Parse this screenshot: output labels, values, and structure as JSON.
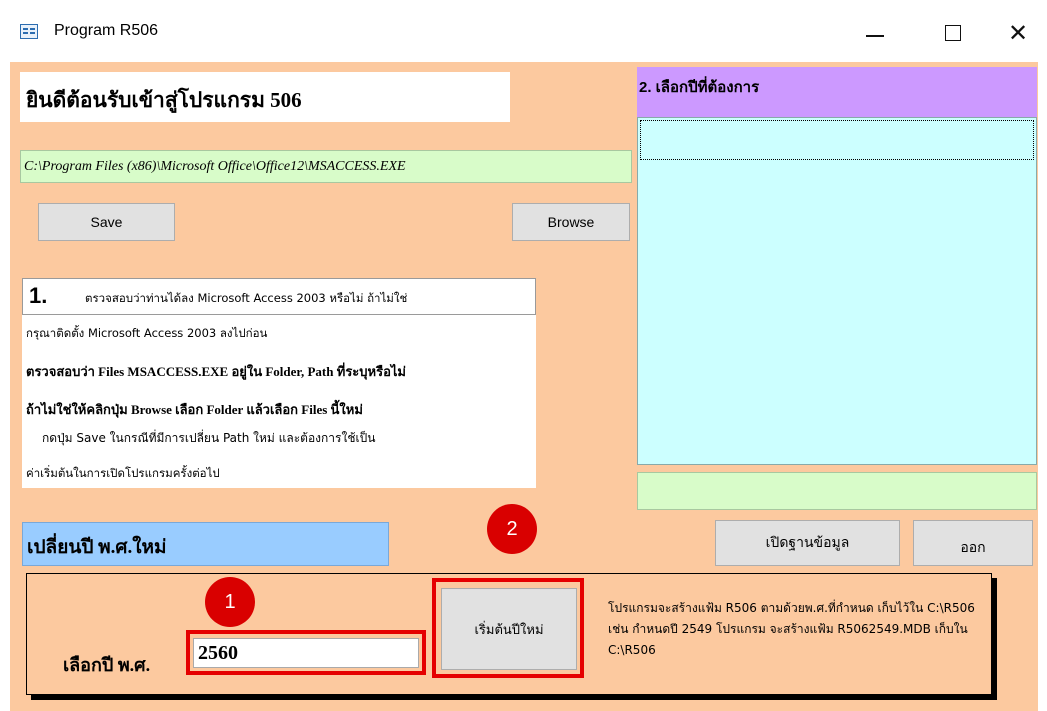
{
  "window": {
    "title": "Program R506",
    "icon": "form-icon",
    "controls": {
      "minimize": "—",
      "maximize": "☐",
      "close": "✕"
    }
  },
  "welcome_text": "ยินดีต้อนรับเข้าสู่โปรแกรม 506",
  "access_path": "C:\\Program Files (x86)\\Microsoft Office\\Office12\\MSACCESS.EXE",
  "buttons": {
    "save": "Save",
    "browse": "Browse",
    "open_database": "เปิดฐานข้อมูล",
    "exit": "ออก",
    "start_new_year": "เริ่มต้นปีใหม่"
  },
  "instructions": {
    "step_number": "1.",
    "line1": "ตรวจสอบว่าท่านได้ลง Microsoft Access 2003 หรือไม่ ถ้าไม่ใช่",
    "line2": "กรุณาติดตั้ง Microsoft Access 2003 ลงไปก่อน",
    "line3": "ตรวจสอบว่า Files  MSACCESS.EXE อยู่ใน Folder, Path ที่ระบุหรือไม่",
    "line4": "ถ้าไม่ใช่ให้คลิกปุ่ม  Browse เลือก Folder แล้วเลือก Files นี้ใหม่",
    "line5": "กดปุ่ม Save ในกรณีที่มีการเปลี่ยน Path ใหม่ และต้องการใช้เป็น",
    "line6": "ค่าเริ่มต้นในการเปิดโปรแกรมครั้งต่อไป"
  },
  "year_selection": {
    "header": "2. เลือกปีที่ต้องการ",
    "status": ""
  },
  "change_year": {
    "header": "เปลี่ยนปี พ.ศ.ใหม่",
    "label": "เลือกปี พ.ศ.",
    "value": "2560",
    "description": "โปรแกรมจะสร้างแฟ้ม R506 ตามด้วยพ.ศ.ที่กำหนด เก็บไว้ใน C:\\R506 เช่น กำหนดปี 2549 โปรแกรม จะสร้างแฟ้ม R5062549.MDB  เก็บใน C:\\R506"
  },
  "markers": {
    "one": "1",
    "two": "2"
  },
  "colors": {
    "background": "#fcc99f",
    "year_header": "#cc99ff",
    "year_list": "#ccffff",
    "path_field": "#d8fcc9",
    "change_year_header": "#99ccff",
    "highlight": "#e50000"
  }
}
